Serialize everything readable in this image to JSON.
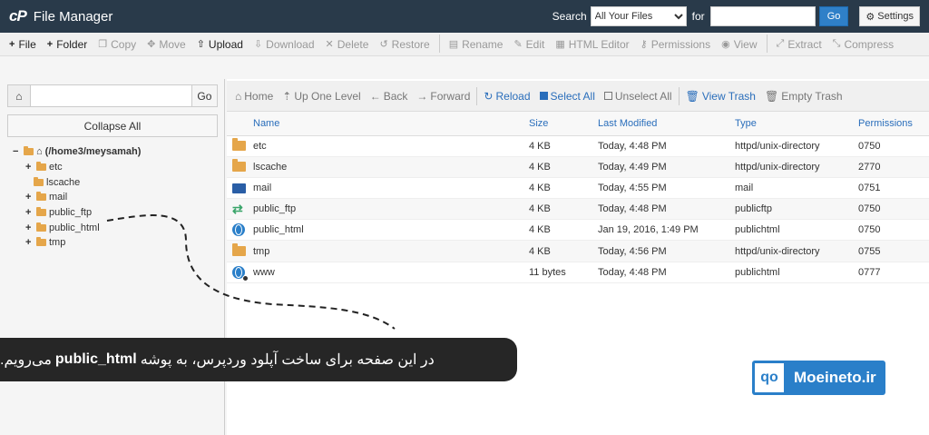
{
  "header": {
    "app_title": "File Manager",
    "logo_text": "cP",
    "search_label": "Search",
    "search_scope": "All Your Files",
    "for_label": "for",
    "search_value": "",
    "go_label": "Go",
    "settings_label": "Settings"
  },
  "toolbar": [
    {
      "label": "File",
      "icon": "plus-icon",
      "enabled": true
    },
    {
      "label": "Folder",
      "icon": "plus-icon",
      "enabled": true
    },
    {
      "label": "Copy",
      "icon": "copy-icon",
      "enabled": false
    },
    {
      "label": "Move",
      "icon": "move-icon",
      "enabled": false
    },
    {
      "label": "Upload",
      "icon": "upload-icon",
      "enabled": true
    },
    {
      "label": "Download",
      "icon": "download-icon",
      "enabled": false
    },
    {
      "label": "Delete",
      "icon": "delete-icon",
      "enabled": false
    },
    {
      "label": "Restore",
      "icon": "restore-icon",
      "enabled": false
    },
    {
      "label": "Rename",
      "icon": "rename-icon",
      "enabled": false
    },
    {
      "label": "Edit",
      "icon": "pencil-icon",
      "enabled": false
    },
    {
      "label": "HTML Editor",
      "icon": "html-editor-icon",
      "enabled": false
    },
    {
      "label": "Permissions",
      "icon": "key-icon",
      "enabled": false
    },
    {
      "label": "View",
      "icon": "eye-icon",
      "enabled": false
    },
    {
      "label": "Extract",
      "icon": "extract-icon",
      "enabled": false
    },
    {
      "label": "Compress",
      "icon": "compress-icon",
      "enabled": false
    }
  ],
  "left": {
    "path_value": "",
    "go_label": "Go",
    "collapse_label": "Collapse All",
    "root_label": "(/home3/meysamah)",
    "tree": [
      {
        "label": "etc",
        "expandable": true
      },
      {
        "label": "lscache",
        "expandable": false
      },
      {
        "label": "mail",
        "expandable": true
      },
      {
        "label": "public_ftp",
        "expandable": true
      },
      {
        "label": "public_html",
        "expandable": true
      },
      {
        "label": "tmp",
        "expandable": true
      }
    ]
  },
  "nav": [
    {
      "label": "Home",
      "icon": "home-icon",
      "style": "grey"
    },
    {
      "label": "Up One Level",
      "icon": "up-arrow-icon",
      "style": "grey"
    },
    {
      "label": "Back",
      "icon": "back-arrow-icon",
      "style": "grey"
    },
    {
      "label": "Forward",
      "icon": "forward-arrow-icon",
      "style": "grey"
    },
    {
      "label": "Reload",
      "icon": "reload-icon",
      "style": "blue"
    },
    {
      "label": "Select All",
      "icon": "checkbox-checked-icon",
      "style": "blue"
    },
    {
      "label": "Unselect All",
      "icon": "checkbox-empty-icon",
      "style": "grey"
    },
    {
      "label": "View Trash",
      "icon": "trash-icon",
      "style": "blue"
    },
    {
      "label": "Empty Trash",
      "icon": "trash-icon",
      "style": "grey"
    }
  ],
  "table": {
    "columns": [
      "Name",
      "Size",
      "Last Modified",
      "Type",
      "Permissions"
    ],
    "rows": [
      {
        "icon": "folder-icon",
        "name": "etc",
        "size": "4 KB",
        "modified": "Today, 4:48 PM",
        "type": "httpd/unix-directory",
        "perms": "0750"
      },
      {
        "icon": "folder-icon",
        "name": "lscache",
        "size": "4 KB",
        "modified": "Today, 4:49 PM",
        "type": "httpd/unix-directory",
        "perms": "2770"
      },
      {
        "icon": "mail-icon",
        "name": "mail",
        "size": "4 KB",
        "modified": "Today, 4:55 PM",
        "type": "mail",
        "perms": "0751"
      },
      {
        "icon": "ftp-icon",
        "name": "public_ftp",
        "size": "4 KB",
        "modified": "Today, 4:48 PM",
        "type": "publicftp",
        "perms": "0750"
      },
      {
        "icon": "globe-icon",
        "name": "public_html",
        "size": "4 KB",
        "modified": "Jan 19, 2016, 1:49 PM",
        "type": "publichtml",
        "perms": "0750"
      },
      {
        "icon": "folder-icon",
        "name": "tmp",
        "size": "4 KB",
        "modified": "Today, 4:56 PM",
        "type": "httpd/unix-directory",
        "perms": "0755"
      },
      {
        "icon": "globe-link-icon",
        "name": "www",
        "size": "11 bytes",
        "modified": "Today, 4:48 PM",
        "type": "publichtml",
        "perms": "0777"
      }
    ]
  },
  "overlay": {
    "banner_before": "در این صفحه برای ساخت آپلود وردپرس، به پوشه",
    "banner_bold": "public_html",
    "banner_after": "می‌رویم.",
    "logo_mark": "qo",
    "logo_text": "Moeineto.ir",
    "colors": {
      "banner_bg": "#262626",
      "logo_blue": "#2a7fc9",
      "header_bg": "#293a4a"
    }
  }
}
